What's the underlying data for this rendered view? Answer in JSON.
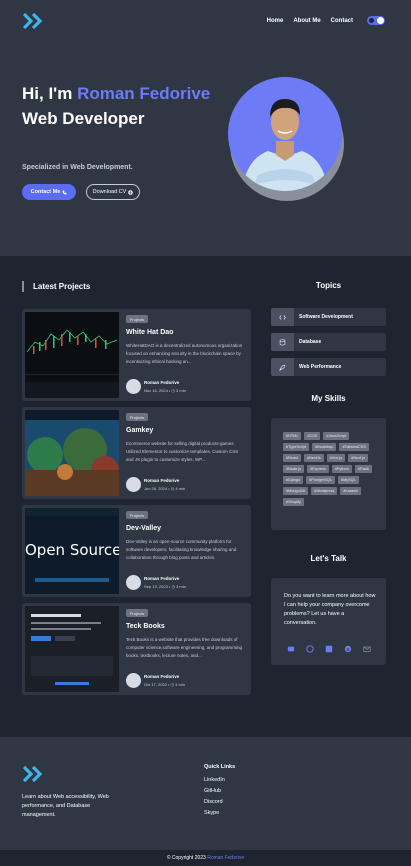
{
  "nav": {
    "home": "Home",
    "about": "About Me",
    "contact": "Contact"
  },
  "hero": {
    "greeting": "Hi, I'm",
    "name": "Roman Fedorive",
    "role": "Web Developer",
    "specialized": "Specialized in Web Development.",
    "contact_btn": "Contact Me",
    "cv_btn": "Download CV"
  },
  "projects": {
    "title": "Latest Projects",
    "items": [
      {
        "tag": "Projects",
        "title": "White Hat Dao",
        "desc": "WhiteHatDAO is a decentralized autonomous organization focused on enhancing security in the blockchain space by incentivizing ethical hacking an...",
        "author": "Roman Fedorive",
        "date": "Nov 16, 2024",
        "read": "3 min"
      },
      {
        "tag": "Projects",
        "title": "Gamkey",
        "desc": "Ecommerce website for selling digital products-games. Utilized Elementor to customize templates, Custom CSS and JS plugin to customize styles, WP...",
        "author": "Roman Fedorive",
        "date": "Jun 26, 2024",
        "read": "4 min"
      },
      {
        "tag": "Projects",
        "title": "Dev-Valley",
        "desc": "Dev-Valley is an open-source community platform for software developers, facilitating knowledge sharing and collaboration through blog posts and articles.",
        "author": "Roman Fedorive",
        "date": "Sep 19, 2023",
        "read": "3 min"
      },
      {
        "tag": "Projects",
        "title": "Teck Books",
        "desc": "Teck Books is a website that provides free downloads of computer science,software engineering, and programming books, textbooks, lecture notes, and...",
        "author": "Roman Fedorive",
        "date": "Oct 17, 2022",
        "read": "3 min"
      }
    ],
    "thumb3_text": "Open Source"
  },
  "topics": {
    "title": "Topics",
    "items": [
      "Software Development",
      "Database",
      "Web Performance"
    ]
  },
  "skills": {
    "title": "My Skills",
    "items": [
      "#HTML",
      "#CSS",
      "#JavaScript",
      "#TypeScript",
      "#Bootstrap",
      "#TailwindCSS",
      "#React",
      "#NextJs",
      "#Vue.js",
      "#Nuxt.js",
      "#Node.js",
      "#Express",
      "#Python",
      "#Flask",
      "#Django",
      "#PostgreSQL",
      "#MySQL",
      "#MongoDB",
      "#Wordpress",
      "#Laravel",
      "#Shopify"
    ]
  },
  "talk": {
    "title": "Let's Talk",
    "text": "Do you want to learn more about how I can help your company overcome problems? Let us have a conversation."
  },
  "footer": {
    "desc": "Learn about Web accessibility, Web performance, and Database management.",
    "quick_links_title": "Quick Links",
    "links": [
      "LinkedIn",
      "GitHub",
      "Discord",
      "Skype"
    ],
    "copyright_prefix": "© Copyright 2023",
    "copyright_name": "Roman Fedorive"
  },
  "colors": {
    "accent": "#6d7cf6",
    "bg": "#1e2430",
    "card": "#2f3644",
    "logo": "#3fb6e6"
  }
}
